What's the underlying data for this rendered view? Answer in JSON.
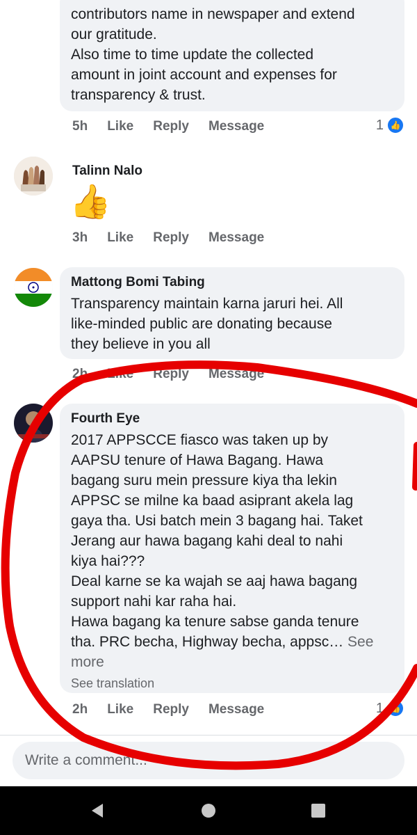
{
  "comments": [
    {
      "author": "",
      "text": "contributors name in newspaper and extend\nour gratitude.\nAlso time to time update the collected\namount in joint account and expenses for\ntransparency & trust.",
      "time": "5h",
      "like_label": "Like",
      "reply_label": "Reply",
      "message_label": "Message",
      "reaction_count": "1"
    },
    {
      "author": "Talinn Nalo",
      "text": "👍",
      "time": "3h",
      "like_label": "Like",
      "reply_label": "Reply",
      "message_label": "Message"
    },
    {
      "author": "Mattong Bomi Tabing",
      "text": "Transparency maintain karna jaruri hei. All\nlike-minded public are donating because\nthey believe in you all",
      "time": "2h",
      "like_label": "Like",
      "reply_label": "Reply",
      "message_label": "Message"
    },
    {
      "author": "Fourth Eye",
      "text": "2017 APPSCCE fiasco was taken up by\nAAPSU tenure of Hawa Bagang. Hawa\nbagang suru mein pressure kiya tha lekin\nAPPSC se milne ka baad asiprant akela lag\ngaya tha. Usi batch mein 3 bagang hai. Taket\nJerang aur hawa bagang kahi deal to nahi\nkiya hai???\nDeal karne se ka wajah se aaj hawa bagang\nsupport nahi kar raha hai.\nHawa bagang ka tenure sabse ganda tenure\ntha. PRC becha, Highway becha, appsc…",
      "see_more": " See\nmore",
      "see_translation": "See translation",
      "time": "2h",
      "like_label": "Like",
      "reply_label": "Reply",
      "message_label": "Message",
      "reaction_count": "1"
    }
  ],
  "composer": {
    "placeholder": "Write a comment..."
  },
  "colors": {
    "accent": "#1877f2",
    "annotation": "#e60000",
    "bubble": "#f0f2f5"
  }
}
